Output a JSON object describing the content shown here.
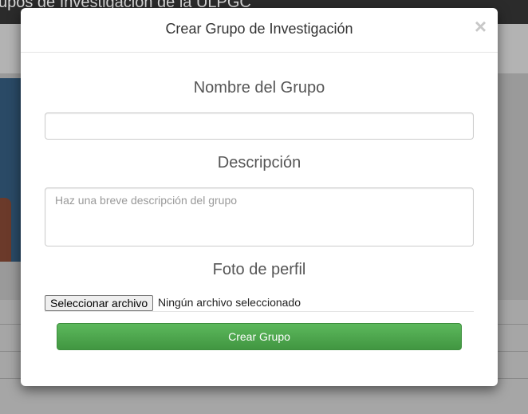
{
  "background": {
    "header_title": "upos de Investigación de la ULPGC"
  },
  "modal": {
    "title": "Crear Grupo de Investigación",
    "close_symbol": "×",
    "name_label": "Nombre del Grupo",
    "name_value": "",
    "description_label": "Descripción",
    "description_placeholder": "Haz una breve descripción del grupo",
    "photo_label": "Foto de perfil",
    "file_button_label": "Seleccionar archivo",
    "file_status": "Ningún archivo seleccionado",
    "submit_label": "Crear Grupo"
  },
  "colors": {
    "submit_green": "#5cb85c",
    "header_dark": "#2b2b2b"
  },
  "icons": {
    "close": "close-icon"
  }
}
